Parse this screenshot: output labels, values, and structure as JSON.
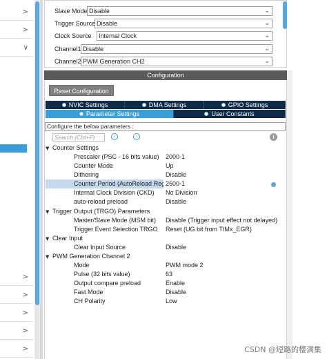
{
  "left_panel": {
    "chevrons": [
      ">",
      ">",
      "∨",
      ">",
      ">",
      ">",
      ">",
      ">"
    ]
  },
  "mode": {
    "rows": [
      {
        "label": "Slave Mode",
        "value": "Disable"
      },
      {
        "label": "Trigger Source",
        "value": "Disable"
      },
      {
        "label": "Clock Source",
        "value": "Internal Clock"
      },
      {
        "label": "Channel1",
        "value": "Disable"
      },
      {
        "label": "Channel2",
        "value": "PWM Generation CH2"
      }
    ]
  },
  "config": {
    "header": "Configuration",
    "reset_label": "Reset Configuration",
    "tabs_row1": [
      "NVIC Settings",
      "DMA Settings",
      "GPIO Settings"
    ],
    "tabs_row2": [
      "Parameter Settings",
      "User Constants"
    ],
    "configure_text": "Configure the below parameters :",
    "search_placeholder": "Search (Ctrl+F)",
    "info_icon": "i",
    "nav_prev": "‹",
    "nav_next": "›"
  },
  "params": {
    "counter_settings": {
      "title": "Counter Settings",
      "items": [
        {
          "name": "Prescaler (PSC - 16 bits value)",
          "value": "2000-1"
        },
        {
          "name": "Counter Mode",
          "value": "Up"
        },
        {
          "name": "Dithering",
          "value": "Disable"
        },
        {
          "name": "Counter Period (AutoReload Reg...",
          "value": "2500-1"
        },
        {
          "name": "Internal Clock Division (CKD)",
          "value": "No Division"
        },
        {
          "name": "auto-reload preload",
          "value": "Disable"
        }
      ]
    },
    "trgo": {
      "title": "Trigger Output (TRGO) Parameters",
      "items": [
        {
          "name": "Master/Slave Mode (MSM bit)",
          "value": "Disable (Trigger input effect not delayed)"
        },
        {
          "name": "Trigger Event Selection TRGO",
          "value": "Reset (UG bit from TIMx_EGR)"
        }
      ]
    },
    "clear_input": {
      "title": "Clear Input",
      "items": [
        {
          "name": "Clear Input Source",
          "value": "Disable"
        }
      ]
    },
    "pwm2": {
      "title": "PWM Generation Channel 2",
      "items": [
        {
          "name": "Mode",
          "value": "PWM mode 2"
        },
        {
          "name": "Pulse (32 bits value)",
          "value": "63"
        },
        {
          "name": "Output compare preload",
          "value": "Enable"
        },
        {
          "name": "Fast Mode",
          "value": "Disable"
        },
        {
          "name": "CH Polarity",
          "value": "Low"
        }
      ]
    }
  },
  "watermark": "CSDN @短路的樱满集",
  "colors": {
    "accent": "#3a9fd6",
    "tab_dark": "#102a4a",
    "header_gray": "#5b5b5b",
    "selected_row": "#c4d8ee"
  }
}
